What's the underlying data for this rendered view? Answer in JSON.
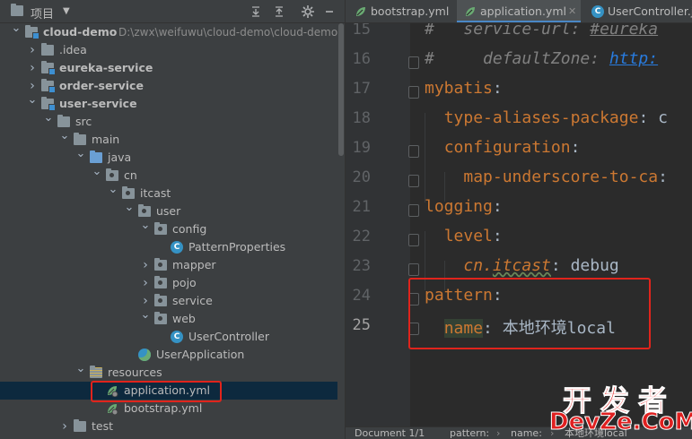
{
  "project": {
    "title": "项目",
    "tree": [
      {
        "label": "cloud-demo",
        "path": "D:\\zwx\\weifuwu\\cloud-demo\\cloud-demo",
        "bold": true,
        "icon": "module-folder-icon",
        "arrow": "expanded"
      },
      {
        "label": ".idea",
        "icon": "folder-icon",
        "arrow": "collapsed"
      },
      {
        "label": "eureka-service",
        "bold": true,
        "icon": "module-folder-icon",
        "arrow": "collapsed"
      },
      {
        "label": "order-service",
        "bold": true,
        "icon": "module-folder-icon",
        "arrow": "collapsed"
      },
      {
        "label": "user-service",
        "bold": true,
        "icon": "module-folder-icon",
        "arrow": "expanded"
      },
      {
        "label": "src",
        "icon": "folder-icon",
        "arrow": "expanded"
      },
      {
        "label": "main",
        "icon": "folder-icon",
        "arrow": "expanded"
      },
      {
        "label": "java",
        "icon": "source-folder-icon",
        "arrow": "expanded"
      },
      {
        "label": "cn",
        "icon": "package-icon",
        "arrow": "expanded"
      },
      {
        "label": "itcast",
        "icon": "package-icon",
        "arrow": "expanded"
      },
      {
        "label": "user",
        "icon": "package-icon",
        "arrow": "expanded"
      },
      {
        "label": "config",
        "icon": "package-icon",
        "arrow": "expanded"
      },
      {
        "label": "PatternProperties",
        "icon": "class-icon",
        "arrow": "none"
      },
      {
        "label": "mapper",
        "icon": "package-icon",
        "arrow": "collapsed"
      },
      {
        "label": "pojo",
        "icon": "package-icon",
        "arrow": "collapsed"
      },
      {
        "label": "service",
        "icon": "package-icon",
        "arrow": "collapsed"
      },
      {
        "label": "web",
        "icon": "package-icon",
        "arrow": "expanded"
      },
      {
        "label": "UserController",
        "icon": "class-icon",
        "arrow": "none"
      },
      {
        "label": "UserApplication",
        "icon": "spring-boot-class-icon",
        "arrow": "none"
      },
      {
        "label": "resources",
        "icon": "resources-folder-icon",
        "arrow": "expanded"
      },
      {
        "label": "application.yml",
        "icon": "spring-yml-icon",
        "arrow": "none",
        "selected": true
      },
      {
        "label": "bootstrap.yml",
        "icon": "spring-yml-icon",
        "arrow": "none"
      },
      {
        "label": "test",
        "icon": "folder-icon",
        "arrow": "collapsed"
      }
    ]
  },
  "tabs": [
    {
      "label": "bootstrap.yml",
      "icon": "spring-yml-icon",
      "active": false
    },
    {
      "label": "application.yml",
      "icon": "spring-yml-icon",
      "active": true
    },
    {
      "label": "UserController.ja",
      "icon": "class-icon",
      "active": false
    }
  ],
  "editor": {
    "line_numbers": [
      "15",
      "16",
      "17",
      "18",
      "19",
      "20",
      "21",
      "22",
      "23",
      "24",
      "25"
    ],
    "lines": [
      {
        "num": "15",
        "text": "#   service-url: #eureka"
      },
      {
        "num": "16",
        "text": "#     defaultZone: http:"
      },
      {
        "num": "17",
        "text": "mybatis:"
      },
      {
        "num": "18",
        "text": "  type-aliases-package: c"
      },
      {
        "num": "19",
        "text": "  configuration:"
      },
      {
        "num": "20",
        "text": "    map-underscore-to-cam"
      },
      {
        "num": "21",
        "text": "logging:"
      },
      {
        "num": "22",
        "text": "  level:"
      },
      {
        "num": "23",
        "text": "    cn.itcast: debug"
      },
      {
        "num": "24",
        "text": "pattern:"
      },
      {
        "num": "25",
        "text": "  name: 本地环境local"
      }
    ],
    "current_line": "25"
  },
  "status_bar": {
    "document": "Document 1/1",
    "crumb_1": "pattern:",
    "crumb_2": "name:",
    "crumb_3": "本地环境local"
  },
  "watermark": {
    "cn": "开发者",
    "en": "DevZe.CoM"
  },
  "colors": {
    "panel_bg": "#3c3f41",
    "editor_bg": "#2b2b2b",
    "keyword": "#cc7832",
    "annotation_red": "#e0241c",
    "selection": "#0d293e"
  }
}
